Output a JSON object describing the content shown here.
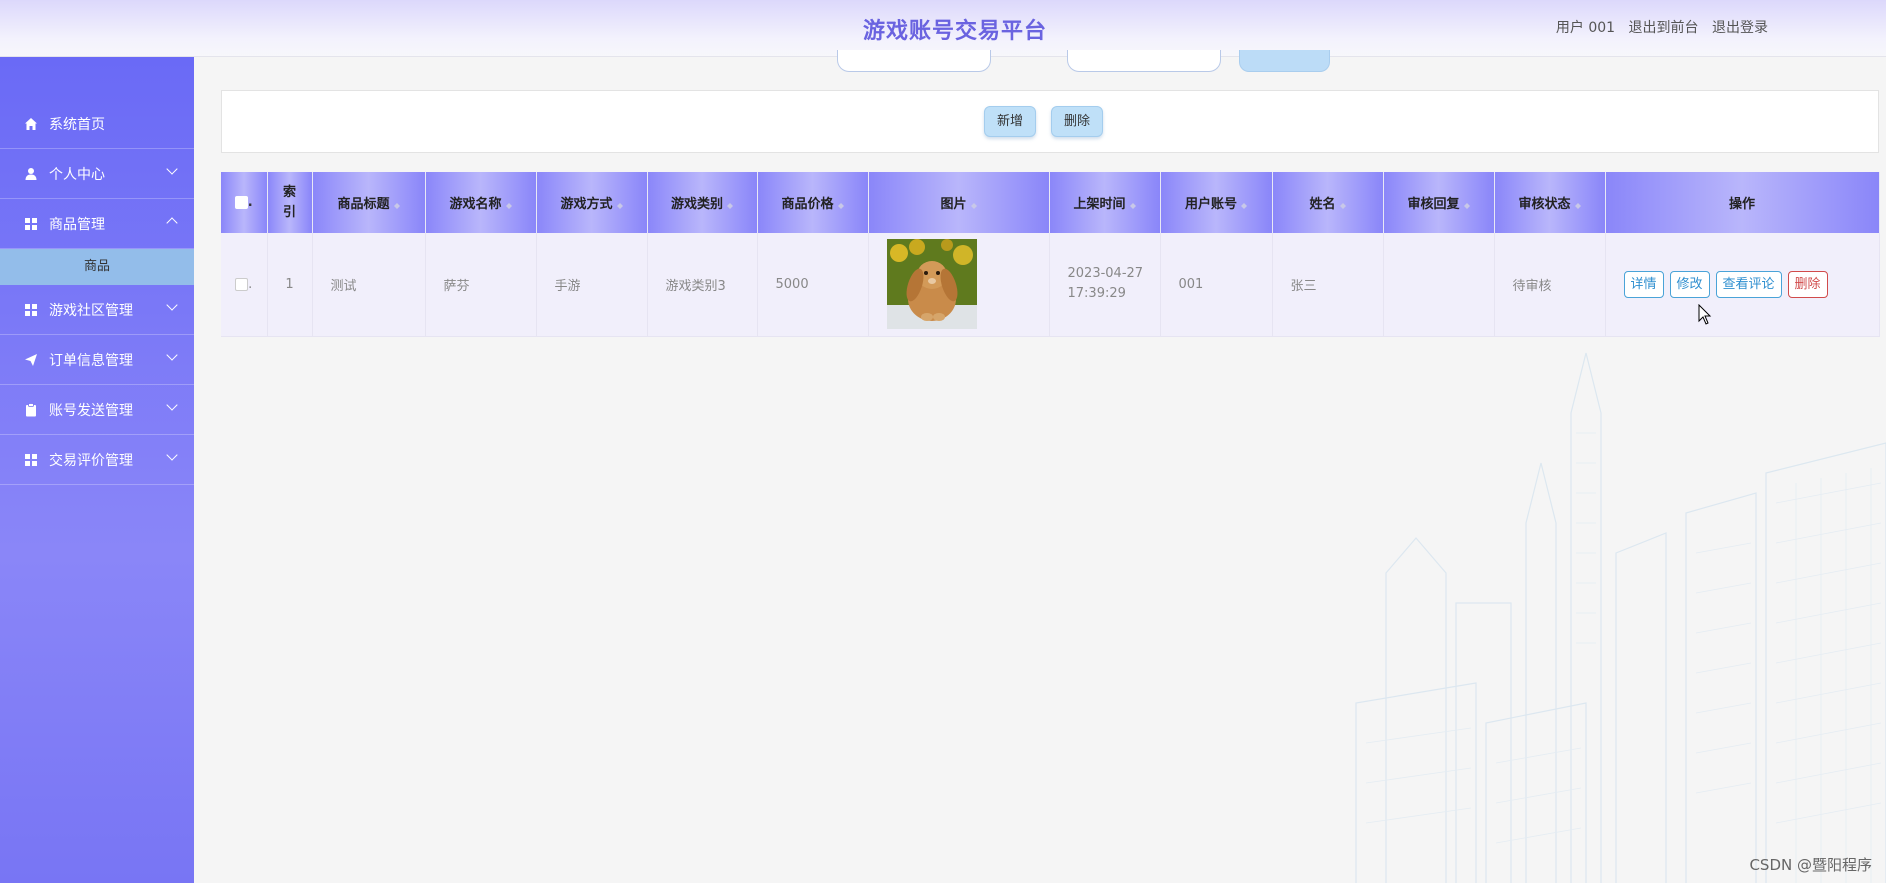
{
  "header": {
    "title": "游戏账号交易平台",
    "user_label": "用户 001",
    "to_frontend": "退出到前台",
    "logout": "退出登录"
  },
  "sidebar": {
    "items": [
      {
        "label": "系统首页",
        "icon": "home-icon"
      },
      {
        "label": "个人中心",
        "icon": "user-icon"
      },
      {
        "label": "商品管理",
        "icon": "grid-icon",
        "expanded": true
      },
      {
        "label": "游戏社区管理",
        "icon": "grid-icon"
      },
      {
        "label": "订单信息管理",
        "icon": "send-icon"
      },
      {
        "label": "账号发送管理",
        "icon": "clipboard-icon"
      },
      {
        "label": "交易评价管理",
        "icon": "grid-icon"
      }
    ],
    "submenu": [
      {
        "label": "商品"
      }
    ]
  },
  "toolbar": {
    "add_label": "新增",
    "delete_label": "删除"
  },
  "table": {
    "headers": [
      "索引",
      "商品标题",
      "游戏名称",
      "游戏方式",
      "游戏类别",
      "商品价格",
      "图片",
      "上架时间",
      "用户账号",
      "姓名",
      "审核回复",
      "审核状态",
      "操作"
    ],
    "rows": [
      {
        "index": "1",
        "title": "测试",
        "game_name": "萨芬",
        "game_mode": "手游",
        "category": "游戏类别3",
        "price": "5000",
        "date": "2023-04-27",
        "time": "17:39:29",
        "account": "001",
        "name": "张三",
        "reply": "",
        "status": "待审核"
      }
    ],
    "actions": {
      "detail": "详情",
      "edit": "修改",
      "comments": "查看评论",
      "delete": "删除"
    }
  },
  "watermark": "CSDN @暨阳程序",
  "colors": {
    "sidebar": "#6a6af6",
    "title": "#6a63e0",
    "header_row": "#8a86f9",
    "submenu_active": "#93bdea"
  }
}
